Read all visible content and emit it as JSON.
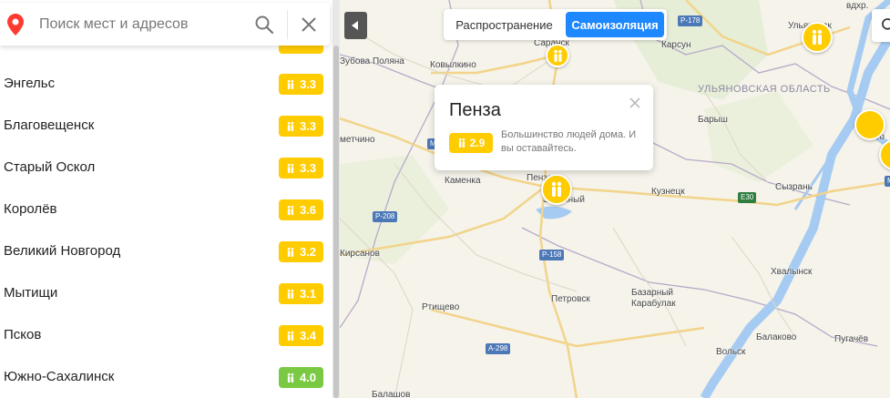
{
  "search": {
    "placeholder": "Поиск мест и адресов"
  },
  "cities": [
    {
      "name": "Энгельс",
      "score": "3.3",
      "color": "#ffcc00"
    },
    {
      "name": "Благовещенск",
      "score": "3.3",
      "color": "#ffcc00"
    },
    {
      "name": "Старый Оскол",
      "score": "3.3",
      "color": "#ffcc00"
    },
    {
      "name": "Королёв",
      "score": "3.6",
      "color": "#ffcc00"
    },
    {
      "name": "Великий Новгород",
      "score": "3.2",
      "color": "#ffcc00"
    },
    {
      "name": "Мытищи",
      "score": "3.1",
      "color": "#ffcc00"
    },
    {
      "name": "Псков",
      "score": "3.4",
      "color": "#ffcc00"
    },
    {
      "name": "Южно-Сахалинск",
      "score": "4.0",
      "color": "#7ac943"
    }
  ],
  "tabs": {
    "spread": "Распространение",
    "isolation": "Самоизоляция"
  },
  "popup": {
    "title": "Пенза",
    "score": "2.9",
    "text": "Большинство людей дома. И вы оставайтесь."
  },
  "map": {
    "labels": {
      "saransk": "Саранск",
      "ulyanovsk": "Ульяновск",
      "kovylkino": "Ковылкино",
      "zubova": "Зубова Поляна",
      "karsun": "Карсун",
      "barysh": "Барыш",
      "kuznetsk": "Кузнецк",
      "syzran": "Сызрань",
      "kamenka": "Каменка",
      "penza": "Пенза",
      "zarechny": "Заречный",
      "kirsanov": "Кирсанов",
      "rtishchevo": "Ртищево",
      "petrovsk": "Петровск",
      "bazarny": "Базарный Карабулак",
      "khvalynsk": "Хвалынск",
      "balakovo": "Балаково",
      "volsk": "Вольск",
      "pugachev": "Пугачёв",
      "tolyatti": "То",
      "metchino": "метчино",
      "vdkhr": "вдхр.",
      "balashov": "Балашов"
    },
    "region": "УЛЬЯНОВСКАЯ ОБЛАСТЬ",
    "roads": {
      "r178": "Р-178",
      "r208": "Р-208",
      "r158": "Р-158",
      "a298": "А-298",
      "e30": "E30",
      "m_left": "М",
      "m_right": "М"
    }
  },
  "colors": {
    "accent": "#1e88ff",
    "badge_yellow": "#ffcc00",
    "badge_green": "#7ac943",
    "water": "#a6cbf2"
  },
  "icons": [
    "location-pin-icon",
    "search-icon",
    "close-icon",
    "people-icon",
    "collapse-arrow-icon"
  ]
}
